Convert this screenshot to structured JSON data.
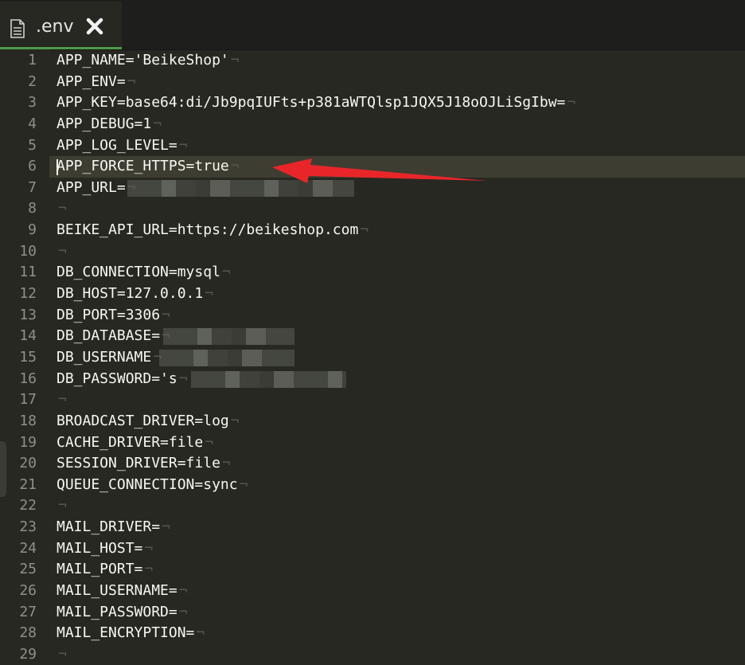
{
  "tab": {
    "filename": ".env",
    "file_icon": "file-text-icon",
    "close_icon": "close-icon"
  },
  "editor": {
    "active_line": 6,
    "eol_marker": "¬",
    "lines": [
      {
        "number": "1",
        "text": "APP_NAME='BeikeShop'"
      },
      {
        "number": "2",
        "text": "APP_ENV="
      },
      {
        "number": "3",
        "text": "APP_KEY=base64:di/Jb9pqIUFts+p381aWTQlsp1JQX5J18oOJLiSgIbw="
      },
      {
        "number": "4",
        "text": "APP_DEBUG=1"
      },
      {
        "number": "5",
        "text": "APP_LOG_LEVEL="
      },
      {
        "number": "6",
        "text": "APP_FORCE_HTTPS=true"
      },
      {
        "number": "7",
        "text": "APP_URL="
      },
      {
        "number": "8",
        "text": ""
      },
      {
        "number": "9",
        "text": "BEIKE_API_URL=https://beikeshop.com"
      },
      {
        "number": "10",
        "text": ""
      },
      {
        "number": "11",
        "text": "DB_CONNECTION=mysql"
      },
      {
        "number": "12",
        "text": "DB_HOST=127.0.0.1"
      },
      {
        "number": "13",
        "text": "DB_PORT=3306"
      },
      {
        "number": "14",
        "text": "DB_DATABASE="
      },
      {
        "number": "15",
        "text": "DB_USERNAME"
      },
      {
        "number": "16",
        "text": "DB_PASSWORD='s"
      },
      {
        "number": "17",
        "text": ""
      },
      {
        "number": "18",
        "text": "BROADCAST_DRIVER=log"
      },
      {
        "number": "19",
        "text": "CACHE_DRIVER=file"
      },
      {
        "number": "20",
        "text": "SESSION_DRIVER=file"
      },
      {
        "number": "21",
        "text": "QUEUE_CONNECTION=sync"
      },
      {
        "number": "22",
        "text": ""
      },
      {
        "number": "23",
        "text": "MAIL_DRIVER="
      },
      {
        "number": "24",
        "text": "MAIL_HOST="
      },
      {
        "number": "25",
        "text": "MAIL_PORT="
      },
      {
        "number": "26",
        "text": "MAIL_USERNAME="
      },
      {
        "number": "27",
        "text": "MAIL_PASSWORD="
      },
      {
        "number": "28",
        "text": "MAIL_ENCRYPTION="
      },
      {
        "number": "29",
        "text": ""
      }
    ]
  },
  "annotation": {
    "arrow_color": "#e8262a",
    "points_to_line": 6
  },
  "colors": {
    "background": "#272822",
    "tabbar": "#1e1f1c",
    "active_line": "#3e3d32",
    "tab_underline": "#4e9a4b",
    "text": "#f8f8f2",
    "line_number": "#90908a",
    "eol": "#55564e"
  }
}
